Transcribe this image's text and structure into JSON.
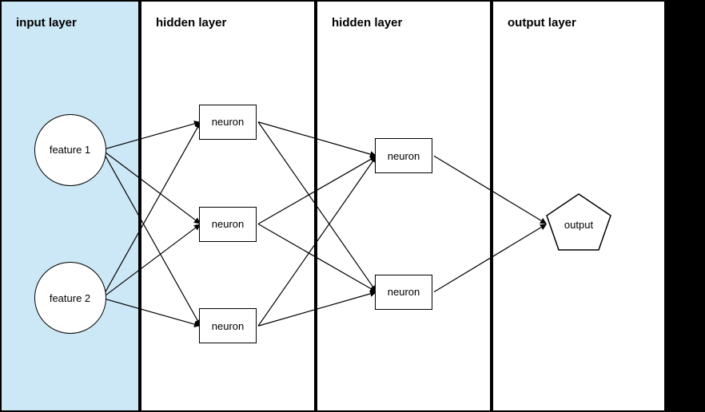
{
  "layers": [
    {
      "id": "input-layer",
      "title": "input layer",
      "type": "input",
      "nodes": [
        {
          "label": "feature 1"
        },
        {
          "label": "feature 2"
        }
      ]
    },
    {
      "id": "hidden-layer-1",
      "title": "hidden layer",
      "type": "hidden",
      "nodes": [
        {
          "label": "neuron"
        },
        {
          "label": "neuron"
        },
        {
          "label": "neuron"
        }
      ]
    },
    {
      "id": "hidden-layer-2",
      "title": "hidden layer",
      "type": "hidden",
      "nodes": [
        {
          "label": "neuron"
        },
        {
          "label": "neuron"
        }
      ]
    },
    {
      "id": "output-layer",
      "title": "output layer",
      "type": "output",
      "nodes": [
        {
          "label": "output"
        }
      ]
    }
  ],
  "colors": {
    "input_bg": "#cce7f5",
    "white": "#ffffff",
    "black": "#000000"
  }
}
